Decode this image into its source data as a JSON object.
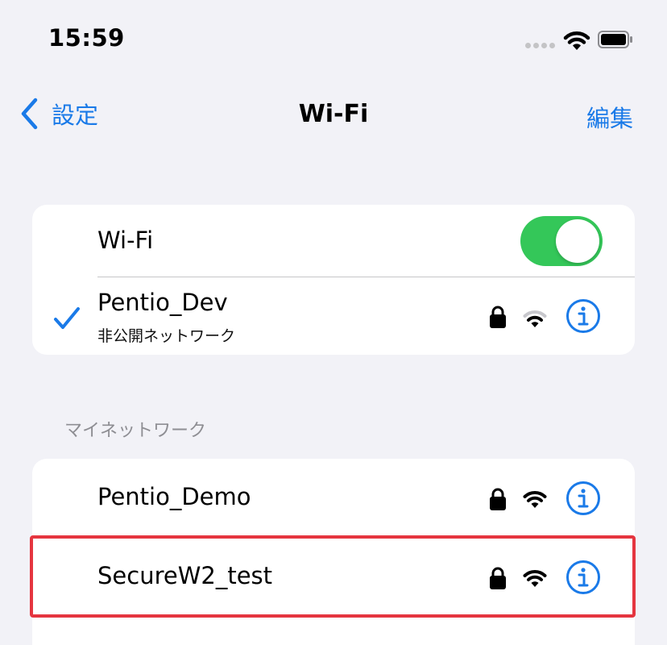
{
  "status_bar": {
    "time": "15:59"
  },
  "nav": {
    "back_label": "設定",
    "title": "Wi-Fi",
    "edit_label": "編集"
  },
  "wifi_toggle": {
    "label": "Wi-Fi",
    "enabled": true
  },
  "current_network": {
    "name": "Pentio_Dev",
    "subtitle": "非公開ネットワーク",
    "connected": true,
    "secured": true
  },
  "my_networks": {
    "header": "マイネットワーク",
    "items": [
      {
        "name": "Pentio_Demo",
        "secured": true
      },
      {
        "name": "SecureW2_test",
        "secured": true
      }
    ]
  },
  "colors": {
    "accent": "#1a7ae8",
    "toggle_on": "#34c759",
    "highlight": "#e5353f"
  },
  "icons": [
    "chevron-left-icon",
    "checkmark-icon",
    "lock-icon",
    "wifi-icon",
    "info-icon",
    "battery-icon"
  ]
}
